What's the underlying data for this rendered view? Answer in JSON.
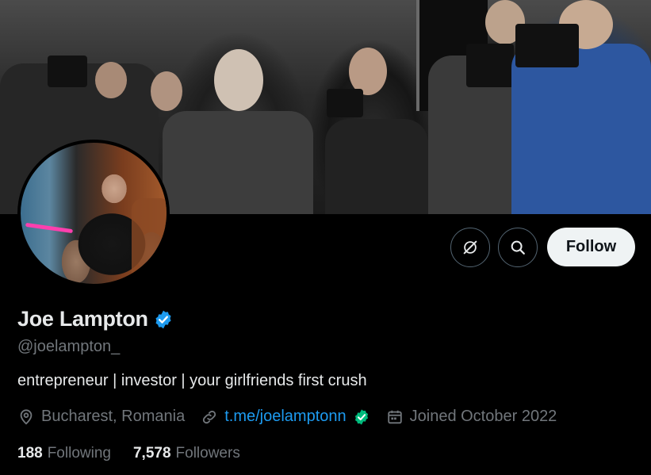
{
  "profile": {
    "display_name": "Joe Lampton",
    "handle": "@joelampton_",
    "bio": "entrepreneur | investor | your girlfriends first crush",
    "location": "Bucharest, Romania",
    "link": "t.me/joelamptonn",
    "joined": "Joined October 2022",
    "following_count": "188",
    "following_label": "Following",
    "followers_count": "7,578",
    "followers_label": "Followers"
  },
  "actions": {
    "follow_label": "Follow",
    "grok_icon": "grok-icon",
    "search_icon": "search-icon"
  },
  "icons": {
    "verified": "verified-badge-icon",
    "location": "location-pin-icon",
    "link": "link-icon",
    "calendar": "calendar-icon",
    "link_verified": "green-check-icon"
  },
  "colors": {
    "background": "#000000",
    "accent": "#1d9bf0",
    "muted": "#71767b",
    "text": "#e7e9ea",
    "follow_bg": "#eff3f4",
    "verified_green": "#00ba7c"
  }
}
